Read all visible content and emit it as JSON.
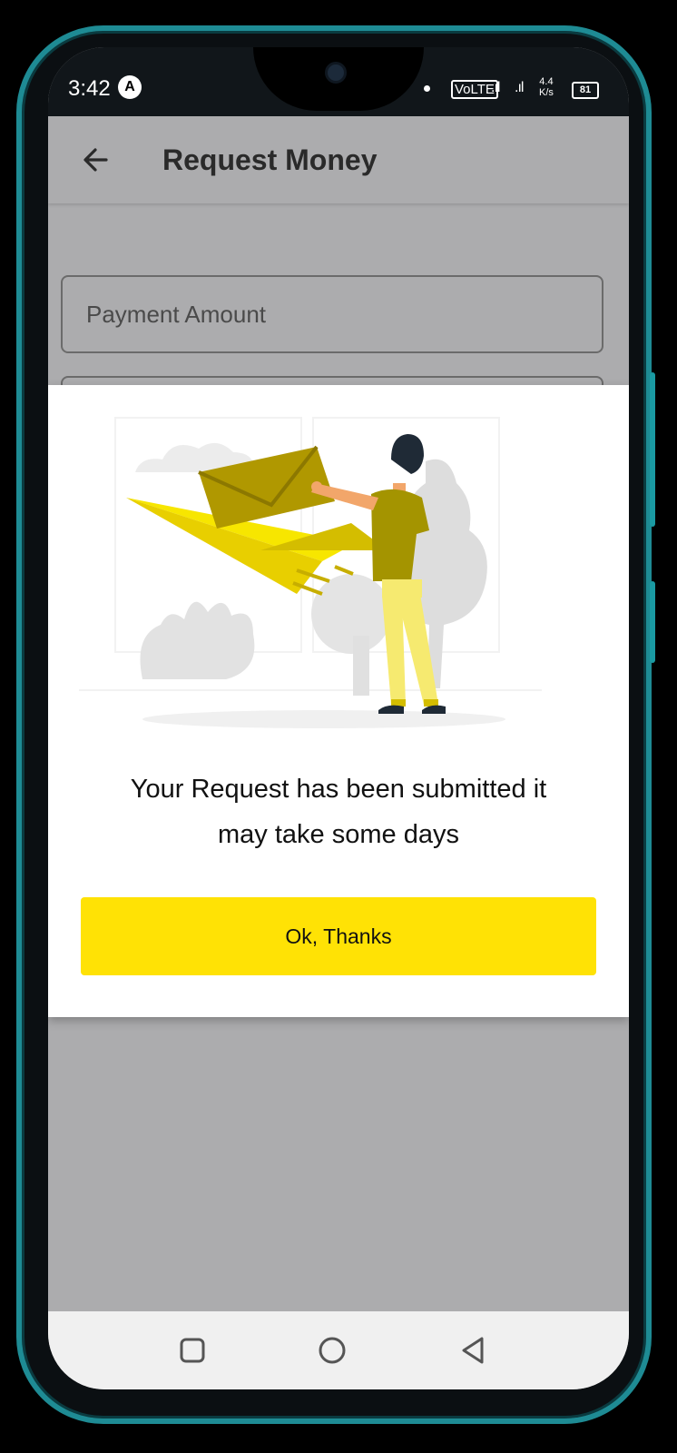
{
  "status_bar": {
    "time": "3:42",
    "app_badge": "A",
    "volte": "VoLTE",
    "signal1": ".ıl",
    "signal2": ".ıl",
    "speed_value": "4.4",
    "speed_unit": "K/s",
    "battery": "81"
  },
  "app_bar": {
    "title": "Request Money",
    "back_icon": "arrow-left-icon"
  },
  "form": {
    "payment_amount_label": "Payment Amount"
  },
  "dialog": {
    "message_line1": "Your Request has been submitted it",
    "message_line2": "may take some days",
    "ok_label": "Ok, Thanks"
  },
  "nav_bar": {
    "icons": [
      "recent-apps-icon",
      "home-icon",
      "back-icon"
    ]
  },
  "colors": {
    "accent": "#ffe205",
    "scrim": "#acacae",
    "frame": "#1e8b94"
  }
}
